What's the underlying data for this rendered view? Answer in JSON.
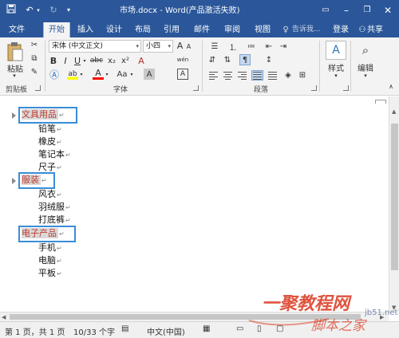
{
  "window": {
    "title": "市场.docx - Word(产品激活失败)",
    "minimize_icon": "minimize-icon",
    "maximize_icon": "maximize-icon",
    "close_icon": "close-icon"
  },
  "quick_access": [
    "save-icon",
    "undo-icon",
    "redo-icon",
    "customize-icon"
  ],
  "ribbon_tabs": [
    "文件",
    "开始",
    "插入",
    "设计",
    "布局",
    "引用",
    "邮件",
    "审阅",
    "视图"
  ],
  "ribbon_active_tab": "开始",
  "tell_me": "告诉我...",
  "account": {
    "login": "登录",
    "share": "共享"
  },
  "ribbon": {
    "clipboard": {
      "paste": "粘贴",
      "label": "剪贴板"
    },
    "font": {
      "font_name": "宋体 (中文正文)",
      "font_size": "小四",
      "bold": "B",
      "italic": "I",
      "underline": "U",
      "strike": "abc",
      "subscript": "x₂",
      "superscript": "x²",
      "clear": "A",
      "font_color": "A",
      "highlight": "ab",
      "case": "Aa",
      "grow": "A",
      "shrink": "A",
      "phonetic": "wén",
      "border_char": "A",
      "label": "字体"
    },
    "paragraph": {
      "label": "段落"
    },
    "styles": {
      "label": "样式"
    },
    "editing": {
      "label": "编辑"
    }
  },
  "document": {
    "lines": [
      {
        "text": "文具用品",
        "type": "heading"
      },
      {
        "text": "铅笔",
        "type": "item"
      },
      {
        "text": "橡皮",
        "type": "item"
      },
      {
        "text": "笔记本",
        "type": "item"
      },
      {
        "text": "尺子",
        "type": "item"
      },
      {
        "text": "服装",
        "type": "heading"
      },
      {
        "text": "风衣",
        "type": "item"
      },
      {
        "text": "羽绒服",
        "type": "item"
      },
      {
        "text": "打底裤",
        "type": "item"
      },
      {
        "text": "电子产品",
        "type": "heading"
      },
      {
        "text": "手机",
        "type": "item"
      },
      {
        "text": "电脑",
        "type": "item"
      },
      {
        "text": "平板",
        "type": "item"
      }
    ],
    "paragraph_mark": "↵"
  },
  "status": {
    "page": "第 1 页，共 1 页",
    "words": "10/33 个字",
    "language": "中文(中国)"
  },
  "watermark": {
    "text": "一聚教程网",
    "text2": "脚本之家",
    "url": "jb51.net"
  },
  "colors": {
    "title_bar": "#2b579a",
    "heading_text": "#c0392b",
    "heading_shade": "#d9d9d9",
    "highlight_box": "#3a8cd8"
  }
}
